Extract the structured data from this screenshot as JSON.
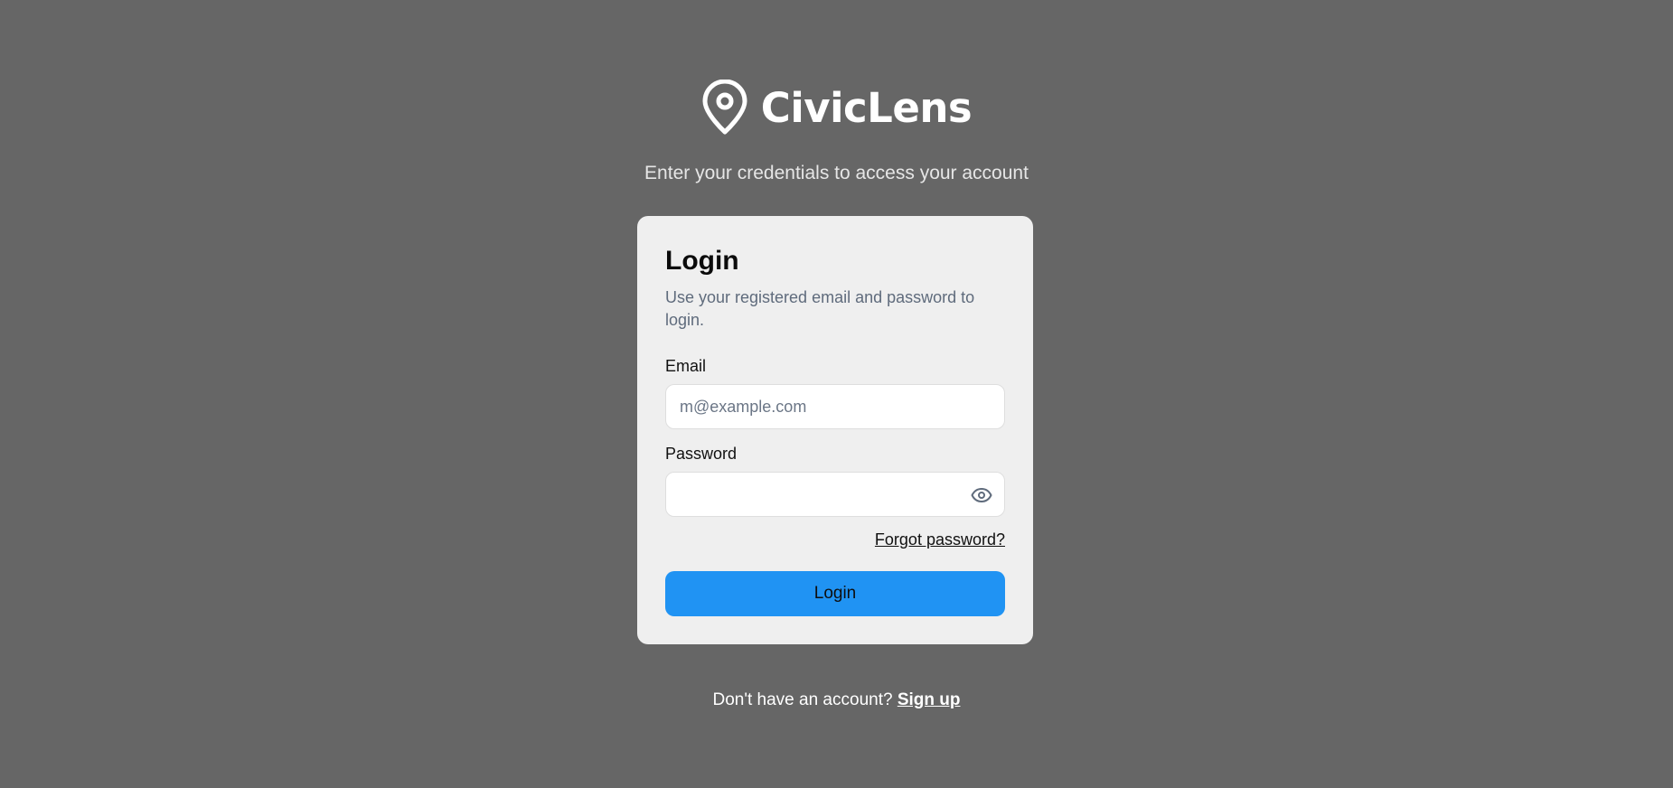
{
  "brand": {
    "name": "CivicLens",
    "icon": "map-pin-icon"
  },
  "tagline": "Enter your credentials to access your account",
  "login_card": {
    "title": "Login",
    "description": "Use your registered email and password to login.",
    "email": {
      "label": "Email",
      "placeholder": "m@example.com",
      "value": ""
    },
    "password": {
      "label": "Password",
      "value": "",
      "toggle_icon": "eye-icon"
    },
    "forgot_password": "Forgot password?",
    "submit_label": "Login"
  },
  "footer": {
    "prompt": "Don't have an account?",
    "signup_label": "Sign up"
  },
  "colors": {
    "background": "#666666",
    "card": "#efefef",
    "primary": "#2093f3",
    "muted_text": "#5f6b7c"
  }
}
